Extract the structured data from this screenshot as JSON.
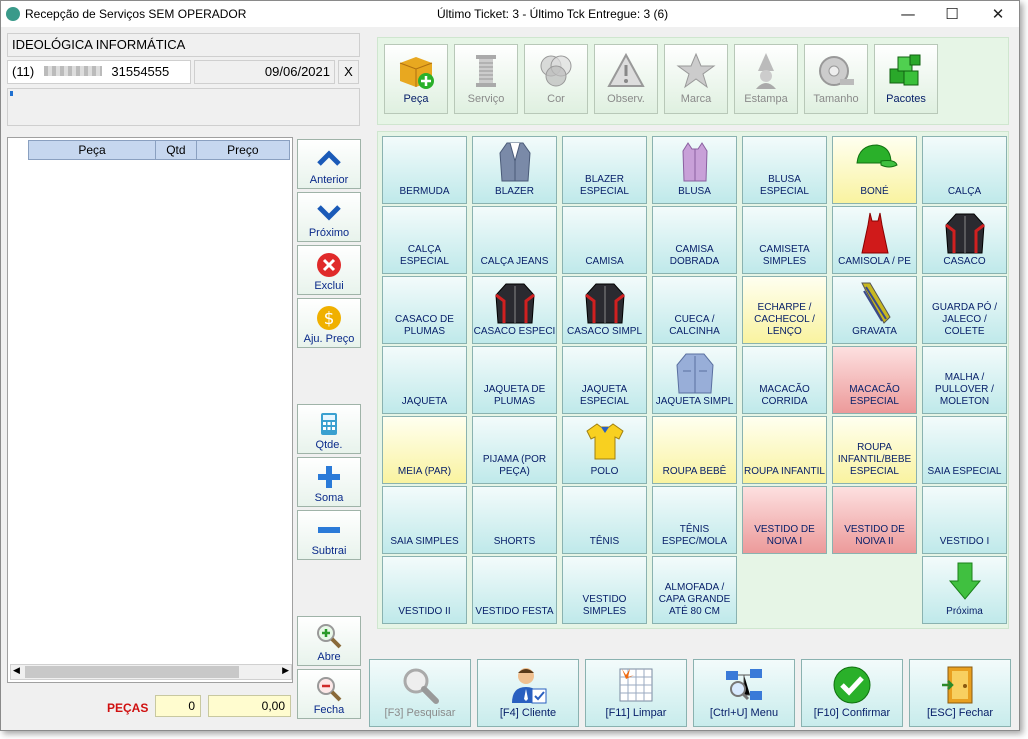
{
  "window": {
    "title": "Recepção de Serviços SEM OPERADOR",
    "center_title": "Último Ticket: 3  - Último Tck Entregue: 3  (6)",
    "min_glyph": "—",
    "max_glyph": "☐",
    "close_glyph": "✕"
  },
  "client": {
    "company": "IDEOLÓGICA INFORMÁTICA",
    "phone_area": "(11)",
    "phone_number": "31554555",
    "date": "09/06/2021",
    "clear_label": "X"
  },
  "grid": {
    "columns": [
      "Peça",
      "Qtd",
      "Preço"
    ],
    "scroll_left": "◀",
    "scroll_right": "▶"
  },
  "side_buttons": [
    {
      "label": "Anterior",
      "icon": "chevron-up-icon"
    },
    {
      "label": "Próximo",
      "icon": "chevron-down-icon"
    },
    {
      "label": "Exclui",
      "icon": "delete-icon"
    },
    {
      "label": "Aju. Preço",
      "icon": "dollar-icon"
    },
    {
      "label": "Qtde.",
      "icon": "calculator-icon"
    },
    {
      "label": "Soma",
      "icon": "plus-icon"
    },
    {
      "label": "Subtrai",
      "icon": "minus-icon"
    },
    {
      "label": "Abre",
      "icon": "zoom-in-icon"
    },
    {
      "label": "Fecha",
      "icon": "zoom-out-icon"
    }
  ],
  "categories": [
    {
      "label": "Peça",
      "icon": "box-add-icon",
      "enabled": true
    },
    {
      "label": "Serviço",
      "icon": "thread-spool-icon",
      "enabled": false
    },
    {
      "label": "Cor",
      "icon": "color-circles-icon",
      "enabled": false
    },
    {
      "label": "Observ.",
      "icon": "warning-icon",
      "enabled": false
    },
    {
      "label": "Marca",
      "icon": "star-icon",
      "enabled": false
    },
    {
      "label": "Estampa",
      "icon": "wizard-icon",
      "enabled": false
    },
    {
      "label": "Tamanho",
      "icon": "tape-measure-icon",
      "enabled": false
    },
    {
      "label": "Pacotes",
      "icon": "cubes-icon",
      "enabled": true
    }
  ],
  "items": [
    {
      "label": "BERMUDA",
      "color": "cyan"
    },
    {
      "label": "BLAZER",
      "color": "cyan",
      "icon": "blazer-icon"
    },
    {
      "label": "BLAZER ESPECIAL",
      "color": "cyan"
    },
    {
      "label": "BLUSA",
      "color": "cyan",
      "icon": "blouse-icon"
    },
    {
      "label": "BLUSA ESPECIAL",
      "color": "cyan"
    },
    {
      "label": "BONÉ",
      "color": "yellow",
      "icon": "cap-icon"
    },
    {
      "label": "CALÇA",
      "color": "cyan"
    },
    {
      "label": "CALÇA ESPECIAL",
      "color": "cyan"
    },
    {
      "label": "CALÇA JEANS",
      "color": "cyan"
    },
    {
      "label": "CAMISA",
      "color": "cyan"
    },
    {
      "label": "CAMISA DOBRADA",
      "color": "cyan"
    },
    {
      "label": "CAMISETA SIMPLES",
      "color": "cyan"
    },
    {
      "label": "CAMISOLA / PE",
      "color": "cyan",
      "icon": "nightgown-icon"
    },
    {
      "label": "CASACO",
      "color": "cyan",
      "icon": "jacket-icon"
    },
    {
      "label": "CASACO DE PLUMAS",
      "color": "cyan"
    },
    {
      "label": "CASACO ESPECI",
      "color": "cyan",
      "icon": "jacket-icon"
    },
    {
      "label": "CASACO SIMPL",
      "color": "cyan",
      "icon": "jacket-icon"
    },
    {
      "label": "CUECA / CALCINHA",
      "color": "cyan"
    },
    {
      "label": "ECHARPE / CACHECOL / LENÇO",
      "color": "yellow"
    },
    {
      "label": "GRAVATA",
      "color": "cyan",
      "icon": "tie-icon"
    },
    {
      "label": "GUARDA PÓ / JALECO / COLETE",
      "color": "cyan"
    },
    {
      "label": "JAQUETA",
      "color": "cyan"
    },
    {
      "label": "JAQUETA DE PLUMAS",
      "color": "cyan"
    },
    {
      "label": "JAQUETA ESPECIAL",
      "color": "cyan"
    },
    {
      "label": "JAQUETA SIMPL",
      "color": "cyan",
      "icon": "denim-jacket-icon"
    },
    {
      "label": "MACACÃO CORRIDA",
      "color": "cyan"
    },
    {
      "label": "MACACÃO ESPECIAL",
      "color": "red"
    },
    {
      "label": "MALHA / PULLOVER / MOLETON",
      "color": "cyan"
    },
    {
      "label": "MEIA (PAR)",
      "color": "yellow"
    },
    {
      "label": "PIJAMA (POR PEÇA)",
      "color": "cyan"
    },
    {
      "label": "POLO",
      "color": "cyan",
      "icon": "polo-icon"
    },
    {
      "label": "ROUPA BEBÊ",
      "color": "yellow"
    },
    {
      "label": "ROUPA INFANTIL",
      "color": "yellow"
    },
    {
      "label": "ROUPA INFANTIL/BEBE ESPECIAL",
      "color": "yellow"
    },
    {
      "label": "SAIA ESPECIAL",
      "color": "cyan"
    },
    {
      "label": "SAIA SIMPLES",
      "color": "cyan"
    },
    {
      "label": "SHORTS",
      "color": "cyan"
    },
    {
      "label": "TÊNIS",
      "color": "cyan"
    },
    {
      "label": "TÊNIS ESPEC/MOLA",
      "color": "cyan"
    },
    {
      "label": "VESTIDO DE NOIVA I",
      "color": "red"
    },
    {
      "label": "VESTIDO DE NOIVA II",
      "color": "red"
    },
    {
      "label": "VESTIDO I",
      "color": "cyan"
    },
    {
      "label": "VESTIDO II",
      "color": "cyan"
    },
    {
      "label": "VESTIDO FESTA",
      "color": "cyan"
    },
    {
      "label": "VESTIDO SIMPLES",
      "color": "cyan"
    },
    {
      "label": "ALMOFADA / CAPA GRANDE ATÉ 80 CM",
      "color": "cyan"
    }
  ],
  "next_button": {
    "label": "Próxima",
    "icon": "arrow-down-icon"
  },
  "bottom_buttons": [
    {
      "label": "[F3] Pesquisar",
      "icon": "magnifier-icon",
      "enabled": false
    },
    {
      "label": "[F4] Cliente",
      "icon": "client-icon",
      "enabled": true
    },
    {
      "label": "[F11] Limpar",
      "icon": "clear-grid-icon",
      "enabled": true
    },
    {
      "label": "[Ctrl+U] Menu",
      "icon": "network-menu-icon",
      "enabled": true
    },
    {
      "label": "[F10] Confirmar",
      "icon": "checkmark-icon",
      "enabled": true
    },
    {
      "label": "[ESC] Fechar",
      "icon": "exit-door-icon",
      "enabled": true
    }
  ],
  "totals": {
    "label": "PEÇAS",
    "count": "0",
    "value": "0,00"
  },
  "colors": {
    "item_cyan": "#bfe9ea",
    "item_yellow": "#f9f3a0",
    "item_red": "#ec9a9a",
    "panel_green": "#e6f5e6",
    "label_blue": "#08206a",
    "pecas_red": "#d01010"
  }
}
